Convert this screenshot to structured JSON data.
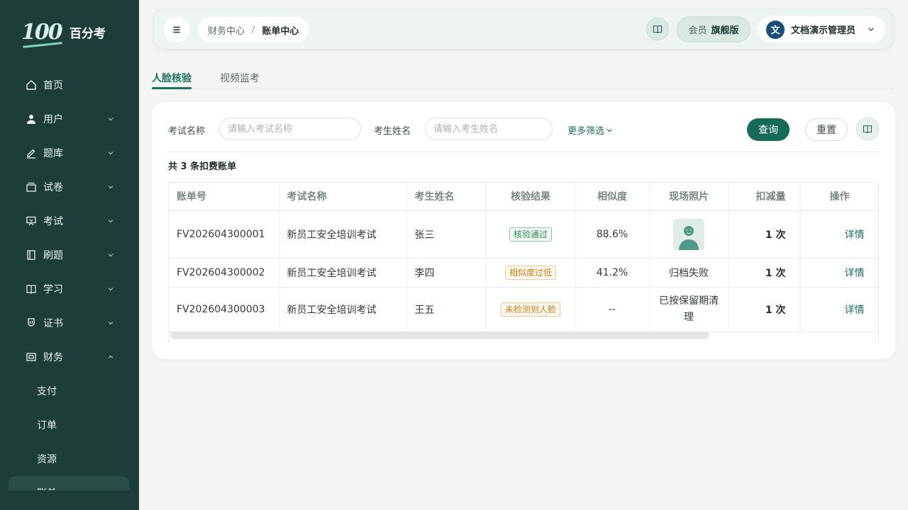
{
  "brand": {
    "logo_text": "百分考",
    "logo_mark": "100"
  },
  "sidebar": {
    "items": [
      {
        "label": "首页",
        "icon": "home-icon"
      },
      {
        "label": "用户",
        "icon": "user-icon"
      },
      {
        "label": "题库",
        "icon": "pen-icon"
      },
      {
        "label": "试卷",
        "icon": "paper-icon"
      },
      {
        "label": "考试",
        "icon": "monitor-icon"
      },
      {
        "label": "刷题",
        "icon": "book-open-icon"
      },
      {
        "label": "学习",
        "icon": "book-icon"
      },
      {
        "label": "证书",
        "icon": "certificate-icon"
      },
      {
        "label": "财务",
        "icon": "wallet-icon"
      }
    ],
    "finance_sub": [
      "支付",
      "订单",
      "资源"
    ],
    "active_sub": "账单"
  },
  "header": {
    "breadcrumb": [
      "财务中心",
      "账单中心"
    ],
    "breadcrumb_sep": "/",
    "vip_label": "会员",
    "vip_level": "旗舰版",
    "user_avatar": "文",
    "user_name": "文档演示管理员"
  },
  "tabs": [
    "人脸核验",
    "视频监考"
  ],
  "filters": {
    "exam_label": "考试名称",
    "exam_placeholder": "请输入考试名称",
    "student_label": "考生姓名",
    "student_placeholder": "请输入考生姓名",
    "more": "更多筛选",
    "query": "查询",
    "reset": "重置"
  },
  "summary": {
    "prefix": "共",
    "count": "3",
    "suffix": "条扣费账单"
  },
  "table": {
    "columns": [
      "账单号",
      "考试名称",
      "考生姓名",
      "核验结果",
      "相似度",
      "现场照片",
      "扣减量",
      "操作"
    ],
    "rows": [
      {
        "id": "FV202604300001",
        "exam": "新员工安全培训考试",
        "name": "张三",
        "result": "核验通过",
        "result_type": "ok",
        "similarity": "88.6%",
        "photo": "",
        "photo_has_image": true,
        "deduct": "1 次",
        "action": "详情"
      },
      {
        "id": "FV202604300002",
        "exam": "新员工安全培训考试",
        "name": "李四",
        "result": "相似度过低",
        "result_type": "warn",
        "similarity": "41.2%",
        "photo": "归档失败",
        "photo_has_image": false,
        "deduct": "1 次",
        "action": "详情"
      },
      {
        "id": "FV202604300003",
        "exam": "新员工安全培训考试",
        "name": "王五",
        "result": "未检测到人脸",
        "result_type": "warn",
        "similarity": "--",
        "photo": "已按保留期清理",
        "photo_has_image": false,
        "deduct": "1 次",
        "action": "详情"
      }
    ]
  },
  "colors": {
    "sidebar": "#1c3d38",
    "primary": "#146b58",
    "accent": "#1c6e5d"
  }
}
